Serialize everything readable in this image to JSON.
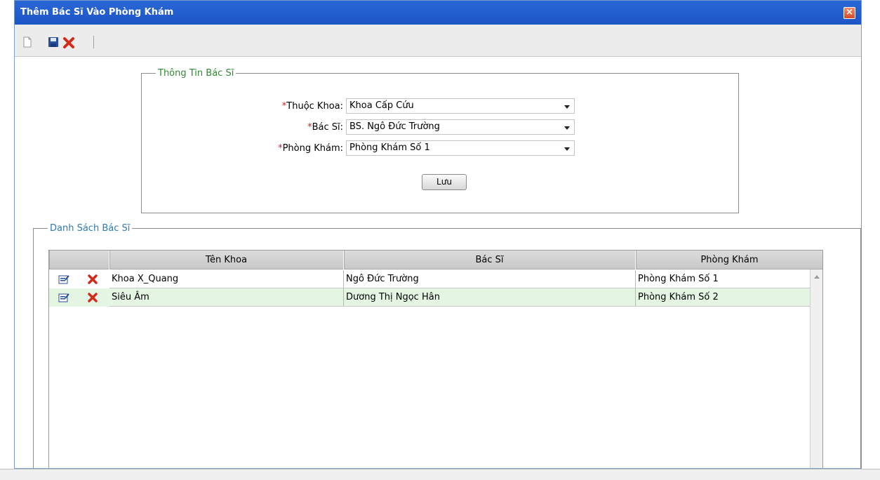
{
  "window": {
    "title": "Thêm Bác Sĩ Vào Phòng Khám",
    "close_label": "×"
  },
  "toolbar": {
    "icons": [
      "new-document-icon",
      "save-icon",
      "delete-icon"
    ]
  },
  "info_section": {
    "legend": "Thông Tin Bác Sĩ",
    "required_mark": "*",
    "fields": [
      {
        "label": "Thuộc Khoa:",
        "value": "Khoa Cấp Cứu"
      },
      {
        "label": "Bác Sĩ:",
        "value": "BS. Ngô Đức Trường"
      },
      {
        "label": "Phòng Khám:",
        "value": "Phòng Khám Số 1"
      }
    ],
    "save_label": "Lưu"
  },
  "list_section": {
    "legend": "Danh Sách Bác Sĩ",
    "columns": [
      "Tên Khoa",
      "Bác Sĩ",
      "Phòng Khám"
    ],
    "rows": [
      {
        "department": "Khoa X_Quang",
        "doctor": "Ngô Đức Trường",
        "clinic": "Phòng Khám Số 1"
      },
      {
        "department": "Siêu Âm",
        "doctor": "Dương Thị Ngọc Hân",
        "clinic": "Phòng Khám Số 2"
      }
    ]
  },
  "colors": {
    "titlebar": "#1c55c6",
    "required": "#d02020",
    "alt_row": "#e4f5e4",
    "info_legend": "#2f8a2f",
    "list_legend": "#2f7ab0"
  }
}
